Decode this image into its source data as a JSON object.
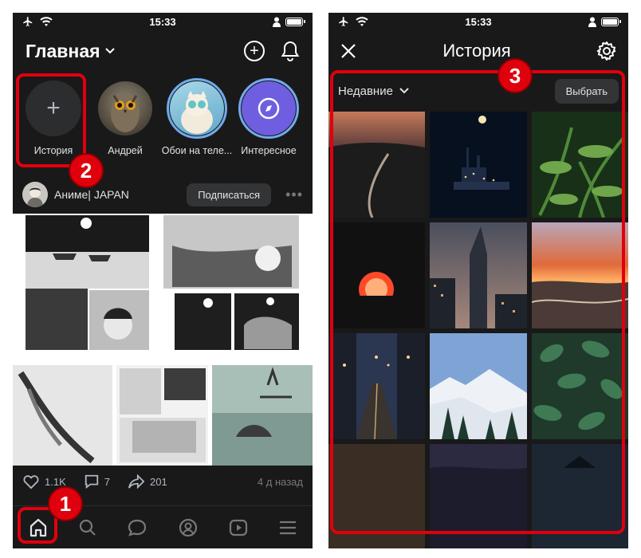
{
  "status_bar": {
    "time": "15:33"
  },
  "left_screen": {
    "title": "Главная",
    "stories": [
      {
        "label": "История",
        "type": "add"
      },
      {
        "label": "Андрей",
        "type": "owl"
      },
      {
        "label": "Обои на теле...",
        "type": "active"
      },
      {
        "label": "Интересное",
        "type": "compass"
      }
    ],
    "post": {
      "author": "Аниме| JAPAN",
      "subscribe_label": "Подписаться",
      "likes": "1.1K",
      "comments": "7",
      "shares": "201",
      "time": "4 д назад"
    },
    "tabbar": [
      "home-icon",
      "search-icon",
      "messages-icon",
      "profile-icon",
      "video-icon",
      "menu-icon"
    ]
  },
  "right_screen": {
    "title": "История",
    "filter_label": "Недавние",
    "select_label": "Выбрать"
  },
  "annotations": [
    "1",
    "2",
    "3"
  ],
  "colors": {
    "background": "#19191a",
    "accent": "#71aaeb",
    "annotation_red": "#e0000d"
  }
}
